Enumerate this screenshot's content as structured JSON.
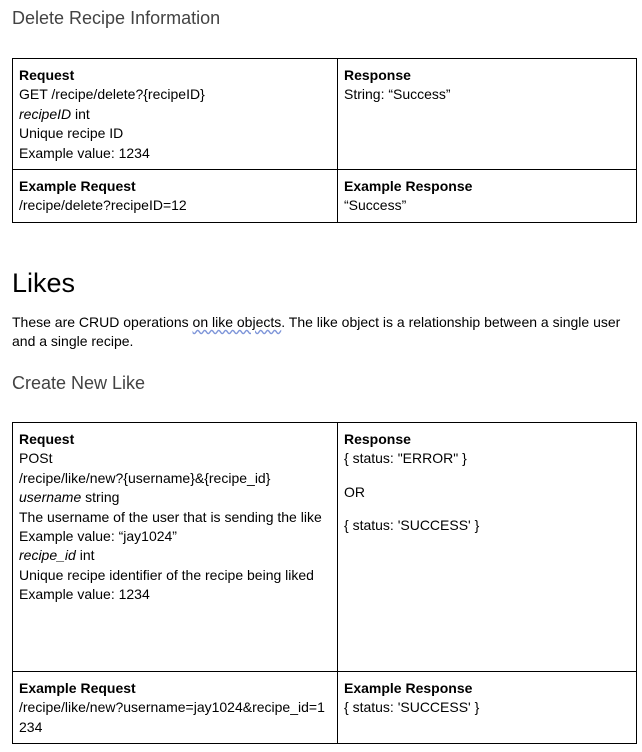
{
  "delete_section": {
    "title": "Delete Recipe Information",
    "request_header": "Request",
    "request_lines": [
      "GET /recipe/delete?{recipeID}"
    ],
    "param1_name": "recipeID",
    "param1_type": " int",
    "param1_desc": "Unique recipe ID",
    "param1_example": "Example value: 1234",
    "response_header": "Response",
    "response_line": "String: “Success”",
    "example_request_header": "Example Request",
    "example_request": "/recipe/delete?recipeID=12",
    "example_response_header": "Example Response",
    "example_response": "“Success”"
  },
  "likes": {
    "heading": "Likes",
    "intro_before": "These are CRUD operations ",
    "intro_wavy": "on like objects",
    "intro_after": ". The like object is a relationship between a single user and a single recipe."
  },
  "create_like": {
    "title": "Create New Like",
    "request_header": "Request",
    "method": "POSt",
    "path": "/recipe/like/new?{username}&{recipe_id}",
    "param1_name": "username",
    "param1_type": " string",
    "param1_desc": "The username of the user that is sending the like",
    "param1_example": "Example value: “jay1024”",
    "param2_name": "recipe_id",
    "param2_type": " int",
    "param2_desc": "Unique recipe identifier of the recipe being liked",
    "param2_example": "Example value: 1234",
    "response_header": "Response",
    "response_error": "{ status: \"ERROR\" }",
    "response_or": "OR",
    "response_success": "{ status: 'SUCCESS' }",
    "example_request_header": "Example Request",
    "example_request": "/recipe/like/new?username=jay1024&recipe_id=1234",
    "example_response_header": "Example Response",
    "example_response": "{ status: 'SUCCESS' }"
  }
}
